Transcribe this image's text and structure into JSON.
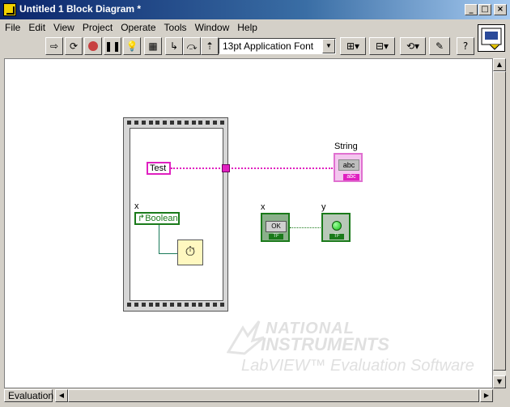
{
  "window": {
    "title": "Untitled 1 Block Diagram *",
    "minimize": "_",
    "maximize": "□",
    "close": "×"
  },
  "menu": [
    "File",
    "Edit",
    "View",
    "Project",
    "Operate",
    "Tools",
    "Window",
    "Help"
  ],
  "toolbar": {
    "font": "13pt Application Font"
  },
  "diagram": {
    "test_constant": "Test",
    "string_label": "String",
    "string_value": "abc",
    "string_tag": "abc",
    "x_label_left": "x",
    "boolean_label": "Boolean",
    "x_label_right": "x",
    "y_label": "y",
    "ok_text": "OK",
    "tf_ok": "TF",
    "tf_led": "TF"
  },
  "watermark": {
    "line1": "NATIONAL",
    "line2": "INSTRUMENTS",
    "line3": "LabVIEW™ Evaluation Software"
  },
  "status": {
    "evaluation": "Evaluation"
  },
  "colors": {
    "string_wire": "#e020c0",
    "boolean_wire": "#1a7a1a",
    "title_bar": "#0a246a"
  }
}
